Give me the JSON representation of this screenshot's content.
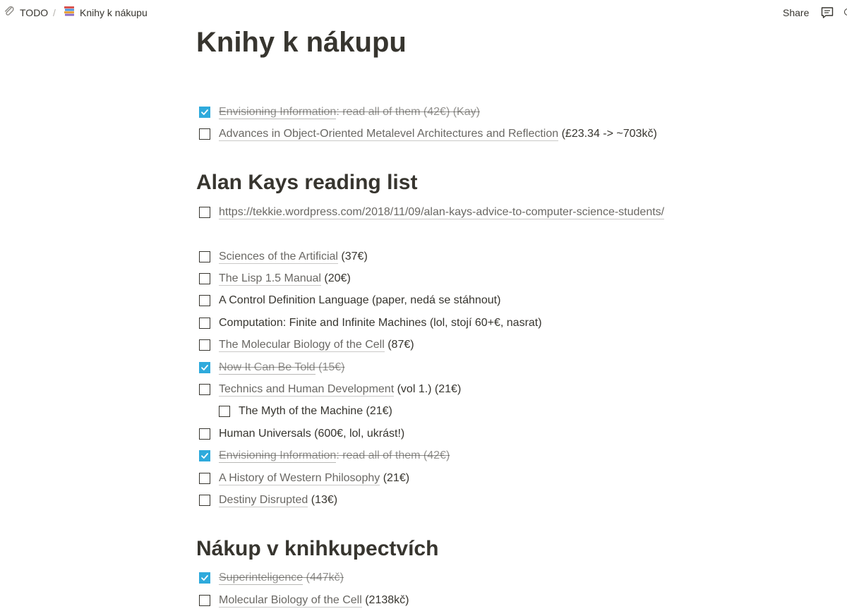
{
  "breadcrumb": {
    "root_label": "TODO",
    "separator": "/",
    "page_label": "Knihy k nákupu"
  },
  "topbar": {
    "share_label": "Share"
  },
  "page": {
    "title": "Knihy k nákupu"
  },
  "intro_items": [
    {
      "link": "Envisioning Information",
      "rest": ": read all of them (42€) (Kay)",
      "checked": true
    },
    {
      "link": "Advances in Object-Oriented Metalevel Architectures and Reflection",
      "rest": " (£23.34 -> ~703kč)",
      "checked": false
    }
  ],
  "sections": [
    {
      "heading": "Alan Kays reading list"
    },
    {
      "heading": "Nákup v knihkupectvích"
    }
  ],
  "kay_link_item": {
    "link": "https://tekkie.wordpress.com/2018/11/09/alan-kays-advice-to-computer-science-students/",
    "checked": false
  },
  "kay_items": [
    {
      "link": "Sciences of the Artificial",
      "rest": " (37€)",
      "checked": false
    },
    {
      "link": "The Lisp 1.5 Manual",
      "rest": " (20€)",
      "checked": false
    },
    {
      "link": "",
      "rest": "A Control Definition Language (paper, nedá se stáhnout)",
      "checked": false
    },
    {
      "link": "",
      "rest": "Computation: Finite and Infinite Machines (lol, stojí 60+€, nasrat)",
      "checked": false
    },
    {
      "link": "The Molecular Biology of the Cell",
      "rest": " (87€)",
      "checked": false
    },
    {
      "link": "Now It Can Be Told",
      "rest": " (15€)",
      "checked": true
    },
    {
      "link": "Technics and Human Development",
      "rest": " (vol 1.) (21€)",
      "checked": false
    },
    {
      "link": "",
      "rest": "The Myth of the Machine (21€)",
      "checked": false,
      "nested": true
    },
    {
      "link": "",
      "rest": "Human Universals (600€, lol, ukrást!)",
      "checked": false
    },
    {
      "link": "Envisioning Information",
      "rest": ": read all of them (42€)",
      "checked": true
    },
    {
      "link": "A History of Western Philosophy",
      "rest": " (21€)",
      "checked": false
    },
    {
      "link": "Destiny Disrupted",
      "rest": " (13€)",
      "checked": false
    }
  ],
  "store_items": [
    {
      "link": "Superinteligence",
      "rest": " (447kč)",
      "checked": true
    },
    {
      "link": "Molecular Biology of the Cell",
      "rest": " (2138kč)",
      "checked": false
    }
  ],
  "colors": {
    "text": "#37352f",
    "checkbox_checked": "#2eaadc"
  },
  "icons": {
    "root": "paperclip-icon",
    "page": "books-icon",
    "comments": "comment-icon",
    "more": "more-icon"
  }
}
